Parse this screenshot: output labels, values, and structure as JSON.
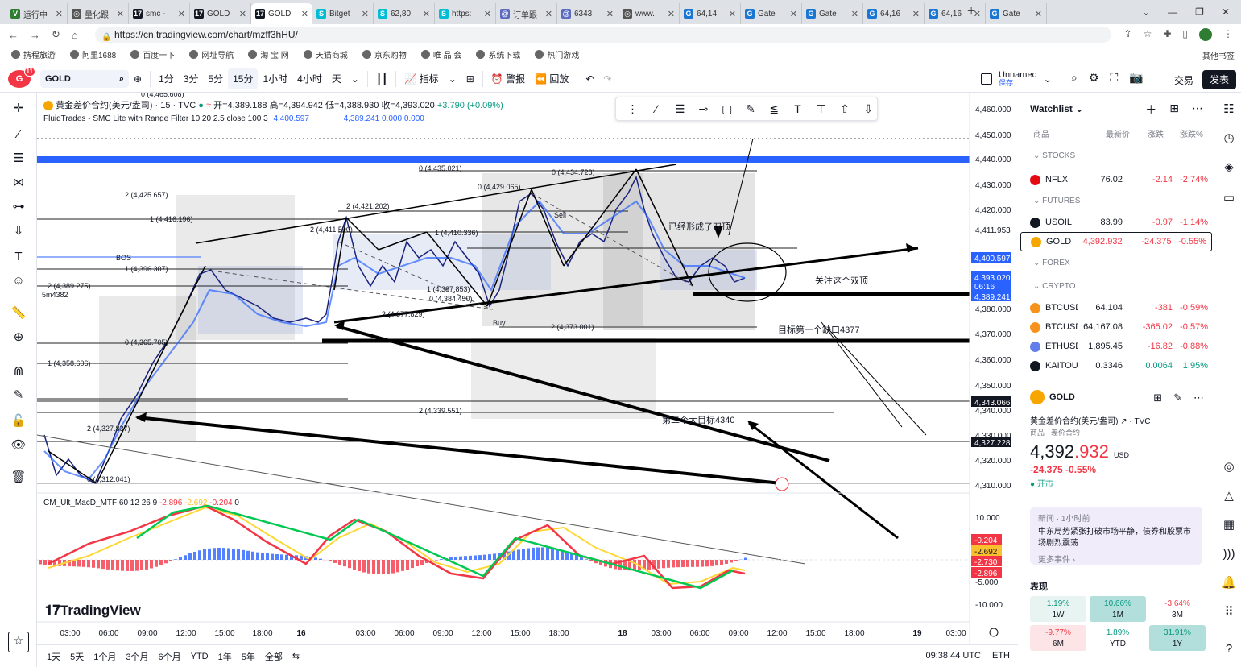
{
  "tabs": [
    {
      "title": "运行中",
      "color": "#2e7d32",
      "icon": "V"
    },
    {
      "title": "量化跟",
      "color": "#555",
      "icon": "◎"
    },
    {
      "title": "smc -",
      "color": "#131722",
      "icon": "17"
    },
    {
      "title": "GOLD",
      "color": "#131722",
      "icon": "17"
    },
    {
      "title": "GOLD",
      "color": "#131722",
      "icon": "17",
      "active": true
    },
    {
      "title": "Bitget",
      "color": "#00bcd4",
      "icon": "S"
    },
    {
      "title": "62,80",
      "color": "#00bcd4",
      "icon": "S"
    },
    {
      "title": "https:",
      "color": "#00bcd4",
      "icon": "S"
    },
    {
      "title": "订单跟",
      "color": "#5c6bc0",
      "icon": "@"
    },
    {
      "title": "6343",
      "color": "#5c6bc0",
      "icon": "@"
    },
    {
      "title": "www.",
      "color": "#555",
      "icon": "◎"
    },
    {
      "title": "64,14",
      "color": "#1976d2",
      "icon": "G"
    },
    {
      "title": "Gate",
      "color": "#1976d2",
      "icon": "G"
    },
    {
      "title": "Gate",
      "color": "#1976d2",
      "icon": "G"
    },
    {
      "title": "64,16",
      "color": "#1976d2",
      "icon": "G"
    },
    {
      "title": "64,16",
      "color": "#1976d2",
      "icon": "G"
    },
    {
      "title": "Gate",
      "color": "#1976d2",
      "icon": "G"
    }
  ],
  "url": "https://cn.tradingview.com/chart/mzff3hHU/",
  "bookmarks": [
    "携程旅游",
    "阿里1688",
    "百度一下",
    "网址导航",
    "淘 宝 网",
    "天猫商城",
    "京东购物",
    "唯 品 会",
    "系统下载",
    "热门游戏"
  ],
  "bookmarks_other": "其他书签",
  "toolbar": {
    "notif": "11",
    "symbol": "GOLD",
    "intervals": [
      "1分",
      "3分",
      "5分",
      "15分",
      "1小时",
      "4小时",
      "天"
    ],
    "active_interval": "15分",
    "indicators": "指标",
    "alert": "警报",
    "replay": "回放",
    "layout_name": "Unnamed",
    "layout_saved": "保存",
    "trade": "交易",
    "publish": "发表"
  },
  "legend": {
    "title": "黄金差价合约(美元/盎司) · 15 · TVC",
    "open": "开=4,389.188",
    "high": "高=4,394.942",
    "low": "低=4,388.930",
    "close": "收=4,393.020",
    "change": "+3.790 (+0.09%)",
    "ind": "FluidTrades - SMC Lite with Range Filter 10 20 2.5 close 100 3",
    "ind_v1": "4,400.597",
    "ind_v2": "4,389.241",
    "ind_v3": "0.000",
    "ind_v4": "0.000",
    "macd": "CM_Ult_MacD_MTF 60 12 26 9",
    "macd_v1": "-2.896",
    "macd_v2": "-2.692",
    "macd_v3": "-0.204",
    "macd_v4": "0"
  },
  "price_axis": [
    "4,460.000",
    "4,450.000",
    "4,440.000",
    "4,430.000",
    "4,420.000",
    "4,411.953",
    "4,400.597",
    "4,393.020",
    "06:16",
    "4,389.241",
    "4,380.000",
    "4,370.000",
    "4,360.000",
    "4,350.000",
    "4,343.066",
    "4,340.000",
    "4,330.000",
    "4,327.228",
    "4,320.000",
    "4,310.000"
  ],
  "macd_axis": [
    "10.000",
    "0.000",
    "-5.000",
    "-10.000"
  ],
  "macd_labels": [
    {
      "v": "-0.204",
      "c": "#f23645"
    },
    {
      "v": "-2.692",
      "c": "#fbc02d"
    },
    {
      "v": "-2.730",
      "c": "#f23645"
    },
    {
      "v": "-2.896",
      "c": "#f23645"
    }
  ],
  "time_axis": [
    "03:00",
    "06:00",
    "09:00",
    "12:00",
    "15:00",
    "18:00",
    "16",
    "03:00",
    "06:00",
    "09:00",
    "12:00",
    "15:00",
    "18:00",
    "18",
    "03:00",
    "06:00",
    "09:00",
    "12:00",
    "15:00",
    "18:00",
    "19",
    "03:00"
  ],
  "annotations": {
    "double_top_formed": "已经形成了双顶",
    "watch_double_top": "关注这个双顶",
    "target_gap": "目标第一个缺口4377",
    "target_big": "第二个大目标4340"
  },
  "level_labels": [
    "0 (4,465.608)",
    "0 (4,435.021)",
    "0 (4,434.728)",
    "2 (4,425.657)",
    "0 (4,429.065)",
    "1 (4,416.196)",
    "2 (4,421.202)",
    "2 (4,411.590)",
    "1 (4,410.336)",
    "1 (4,396.307)",
    "2 (4,389.275)",
    "1 (4,387.853)",
    "0 (4,384.450)",
    "2 (4,377.829)",
    "2 (4,373.001)",
    "0 (4,365.705)",
    "1 (4,358.606)",
    "2 (4,339.551)",
    "2 (4,327.837)",
    "0 (4,312.041)",
    "5m4382",
    "BOS",
    "Sell",
    "Buy"
  ],
  "watermark": "TradingView",
  "ranges": [
    "1天",
    "5天",
    "1个月",
    "3个月",
    "6个月",
    "YTD",
    "1年",
    "5年",
    "全部"
  ],
  "clock": "09:38:44 UTC",
  "currency": "ETH",
  "watchlist": {
    "title": "Watchlist",
    "cols": [
      "商品",
      "最新价",
      "涨跌",
      "涨跌%"
    ],
    "sections": [
      "STOCKS",
      "FUTURES",
      "FOREX",
      "CRYPTO"
    ],
    "rows": [
      {
        "sym": "NFLX",
        "last": "76.02",
        "chg": "-2.14",
        "pct": "-2.74%",
        "color": "#e50914"
      },
      {
        "sym": "USOIL",
        "last": "83.99",
        "chg": "-0.97",
        "pct": "-1.14%",
        "color": "#131722"
      },
      {
        "sym": "GOLD",
        "last": "4,392.932",
        "chg": "-24.375",
        "pct": "-0.55%",
        "color": "#f7a600"
      },
      {
        "sym": "BTCUSD",
        "last": "64,104",
        "chg": "-381",
        "pct": "-0.59%",
        "color": "#f7931a"
      },
      {
        "sym": "BTCUSD",
        "last": "64,167.08",
        "chg": "-365.02",
        "pct": "-0.57%",
        "color": "#f7931a"
      },
      {
        "sym": "ETHUSD",
        "last": "1,895.45",
        "chg": "-16.82",
        "pct": "-0.88%",
        "color": "#627eea"
      },
      {
        "sym": "KAITOU",
        "last": "0.3346",
        "chg": "0.0064",
        "pct": "1.95%",
        "color": "#131722"
      }
    ]
  },
  "detail": {
    "sym": "GOLD",
    "name": "黄金差价合约(美元/盎司)",
    "src": "TVC",
    "type": "商品 · 差价合约",
    "price_main": "4,392",
    "price_dec": ".932",
    "unit": "USD",
    "chg": "-24.375",
    "pct": "-0.55%",
    "status": "开市",
    "news_head": "新闻 · 1小时前",
    "news_body": "中东局势紧张打破市场平静，债券和股票市场剧烈震荡",
    "news_more": "更多事件 ›",
    "perf_title": "表现",
    "perf": [
      {
        "v": "1.19%",
        "p": "1W",
        "bg": "#e8f4f2",
        "c": "#089981"
      },
      {
        "v": "10.66%",
        "p": "1M",
        "bg": "#b2dfdb",
        "c": "#089981"
      },
      {
        "v": "-3.64%",
        "p": "3M",
        "bg": "#fff",
        "c": "#f23645"
      },
      {
        "v": "-9.77%",
        "p": "6M",
        "bg": "#fde4e6",
        "c": "#f23645"
      },
      {
        "v": "1.89%",
        "p": "YTD",
        "bg": "#fff",
        "c": "#089981"
      },
      {
        "v": "31.91%",
        "p": "1Y",
        "bg": "#b2dfdb",
        "c": "#089981"
      }
    ]
  }
}
